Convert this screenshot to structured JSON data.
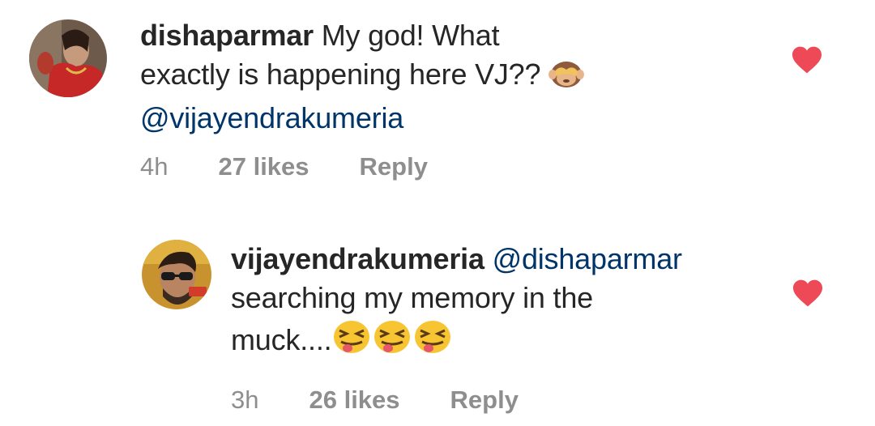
{
  "comments": [
    {
      "username": "dishaparmar",
      "text_line1": " My god! What",
      "text_line2": "exactly is happening here VJ?? ",
      "emoji": "see-no-evil-monkey",
      "mention": "@vijayendrakumeria",
      "time": "4h",
      "likes": "27 likes",
      "reply": "Reply",
      "liked": true
    },
    {
      "username": "vijayendrakumeria",
      "mention": "@dishaparmar",
      "text_line1": "searching my memory in the",
      "text_line2": "muck....",
      "emoji": "squinting-face-with-tongue",
      "emoji_count": 3,
      "time": "3h",
      "likes": "26 likes",
      "reply": "Reply",
      "liked": true
    }
  ],
  "colors": {
    "heart": "#ed4956",
    "mention": "#003569",
    "meta": "#8e8e8e",
    "text": "#262626"
  }
}
